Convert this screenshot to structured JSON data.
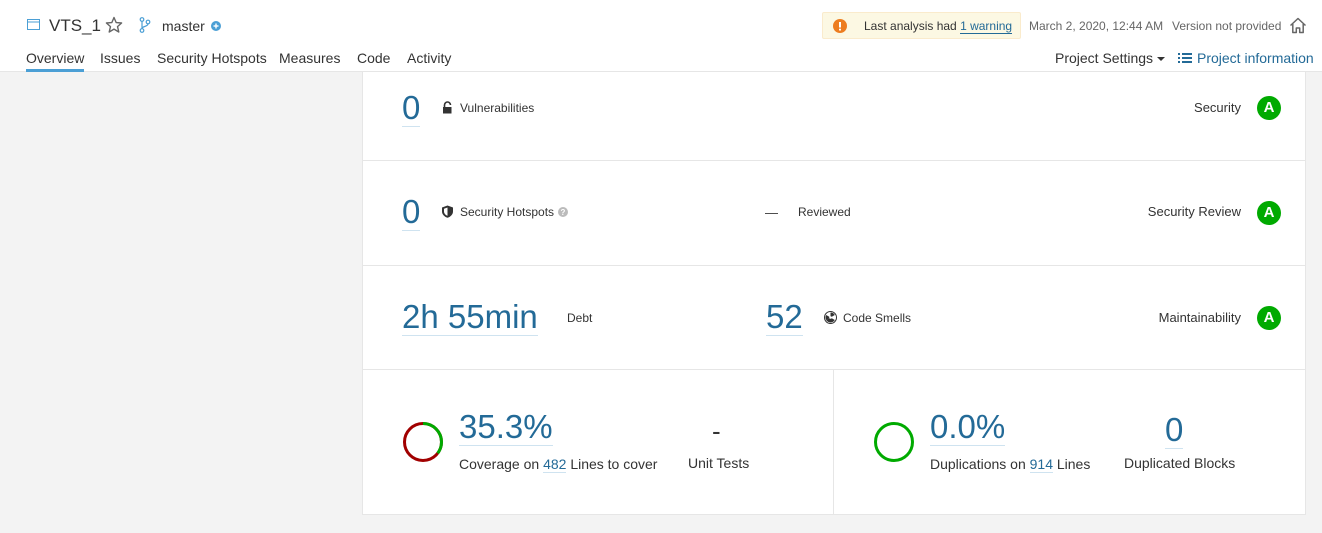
{
  "header": {
    "project_name": "VTS_1",
    "branch": "master",
    "warning_prefix": "Last analysis had",
    "warning_link": "1 warning",
    "analysis_date": "March 2, 2020, 12:44 AM",
    "version": "Version not provided"
  },
  "tabs": [
    "Overview",
    "Issues",
    "Security Hotspots",
    "Measures",
    "Code",
    "Activity"
  ],
  "project_settings": "Project Settings",
  "project_information": "Project information",
  "security": {
    "value": "0",
    "label": "Vulnerabilities",
    "rating_label": "Security",
    "rating": "A"
  },
  "security_review": {
    "value": "0",
    "label": "Security Hotspots",
    "reviewed_value": "—",
    "reviewed_label": "Reviewed",
    "rating_label": "Security Review",
    "rating": "A"
  },
  "maintainability": {
    "debt_value": "2h 55min",
    "debt_label": "Debt",
    "smells_value": "52",
    "smells_label": "Code Smells",
    "rating_label": "Maintainability",
    "rating": "A"
  },
  "coverage": {
    "value": "35.3%",
    "fraction": 0.353,
    "sub_prefix": "Coverage on",
    "lines": "482",
    "sub_suffix": "Lines to cover",
    "unit_tests_value": "-",
    "unit_tests_label": "Unit Tests"
  },
  "duplications": {
    "value": "0.0%",
    "sub_prefix": "Duplications on",
    "lines": "914",
    "sub_suffix": "Lines",
    "blocks_value": "0",
    "blocks_label": "Duplicated Blocks"
  },
  "colors": {
    "link": "#236a97",
    "rating_a": "#00aa00",
    "coverage_uncovered": "#a10000",
    "coverage_covered": "#00aa00",
    "warning_bg": "#fcf8e3",
    "active_tab": "#4b9fd5"
  },
  "icons": {
    "project": "project-icon",
    "favorite": "star-icon",
    "branch": "branch-icon",
    "branch_action": "plus-circle-icon",
    "warning": "exclamation-icon",
    "home": "home-icon",
    "info": "list-icon",
    "vulnerability": "lock-icon",
    "hotspot": "shield-icon",
    "help": "question-icon",
    "code_smell": "radiation-icon"
  }
}
